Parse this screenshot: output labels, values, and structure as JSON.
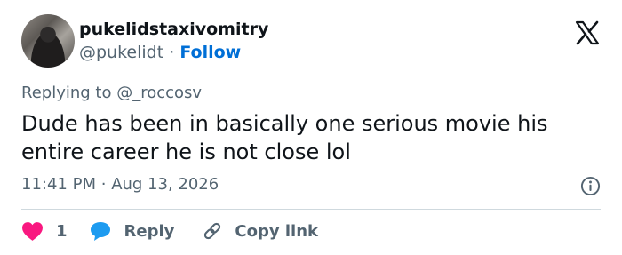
{
  "author": {
    "display_name": "pukelidstaxivomitry",
    "handle": "@pukelidt",
    "separator": "·",
    "follow_label": "Follow"
  },
  "reply_context": {
    "prefix": "Replying to",
    "mention": "@_roccosv"
  },
  "tweet": {
    "text": "Dude has been in basically one serious movie his entire career he is not close lol",
    "time": "11:41 PM",
    "date_separator": "·",
    "date": "Aug 13, 2026"
  },
  "actions": {
    "like_count": "1",
    "reply_label": "Reply",
    "copy_label": "Copy link"
  },
  "colors": {
    "like": "#f91880",
    "reply": "#1d9bf0",
    "link": "#006fd6",
    "muted": "#536471"
  },
  "icons": [
    "avatar",
    "x-logo-icon",
    "info-icon",
    "heart-icon",
    "reply-bubble-icon",
    "link-icon"
  ]
}
